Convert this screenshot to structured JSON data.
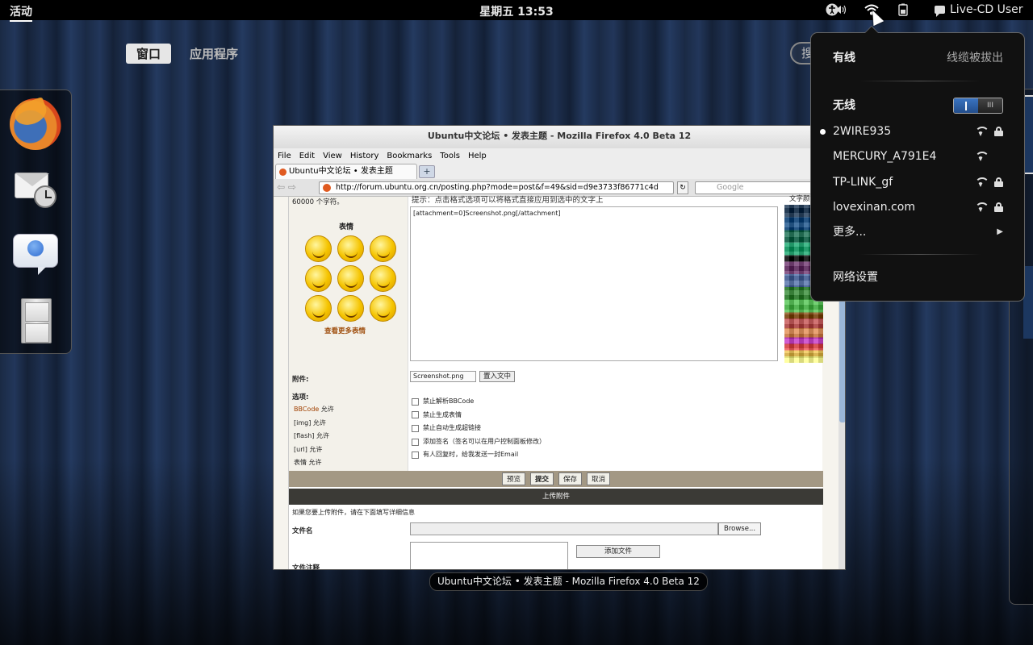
{
  "topbar": {
    "activities": "活动",
    "clock": "星期五 13:53",
    "user": "Live-CD User",
    "tray_icons": [
      "accessibility-icon",
      "volume-icon",
      "network-icon",
      "battery-icon"
    ]
  },
  "overview": {
    "tab_windows": "窗口",
    "tab_apps": "应用程序",
    "search_stub": "搜"
  },
  "dash": {
    "items": [
      "firefox-icon",
      "evolution-icon",
      "empathy-icon",
      "file-cabinet-icon"
    ]
  },
  "firefox": {
    "title": "Ubuntu中文论坛 • 发表主题 - Mozilla Firefox 4.0 Beta 12",
    "menu": [
      "File",
      "Edit",
      "View",
      "History",
      "Bookmarks",
      "Tools",
      "Help"
    ],
    "tab_label": "Ubuntu中文论坛 • 发表主题",
    "new_tab": "+",
    "url": "http://forum.ubuntu.org.cn/posting.php?mode=post&f=49&sid=d9e3733f86771c4d",
    "search_placeholder": "Google",
    "page": {
      "chars_note": "60000 个字符。",
      "smileys_heading": "表情",
      "more_smileys": "查看更多表情",
      "hint": "提示：点击格式选项可以将格式直接应用到选中的文字上",
      "textarea_value": "[attachment=0]Screenshot.png[/attachment]",
      "palette_heading": "文字颜色",
      "attach_label": "附件:",
      "attach_select": "Screenshot.png",
      "insert_button": "置入文中",
      "options_title": "选项:",
      "options": [
        {
          "name": "BBCode",
          "state": "允许"
        },
        {
          "name": "[img]",
          "state": "允许"
        },
        {
          "name": "[flash]",
          "state": "允许"
        },
        {
          "name": "[url]",
          "state": "允许"
        },
        {
          "name": "表情",
          "state": "允许"
        }
      ],
      "checkboxes": [
        "禁止解析BBCode",
        "禁止生成表情",
        "禁止自动生成超链接",
        "添加签名（签名可以在用户控制面板修改）",
        "有人回复时，给我发送一封Email"
      ],
      "buttons": {
        "preview": "预览",
        "submit": "提交",
        "save": "保存",
        "cancel": "取消"
      },
      "upload_heading": "上传附件",
      "upload_note": "如果您要上传附件，请在下面填写详细信息",
      "filename_label": "文件名",
      "browse": "Browse...",
      "add_file": "添加文件",
      "file_comment_label": "文件注释"
    }
  },
  "window_caption": "Ubuntu中文论坛 • 发表主题 - Mozilla Firefox 4.0 Beta 12",
  "network_menu": {
    "wired_label": "有线",
    "wired_status": "线缆被拔出",
    "wireless_label": "无线",
    "wireless_toggle_off": "III",
    "networks": [
      {
        "ssid": "2WIRE935",
        "secured": true,
        "connected": true
      },
      {
        "ssid": "MERCURY_A791E4",
        "secured": false,
        "connected": false
      },
      {
        "ssid": "TP-LINK_gf",
        "secured": true,
        "connected": false
      },
      {
        "ssid": "lovexinan.com",
        "secured": true,
        "connected": false
      }
    ],
    "more": "更多...",
    "settings": "网络设置"
  }
}
